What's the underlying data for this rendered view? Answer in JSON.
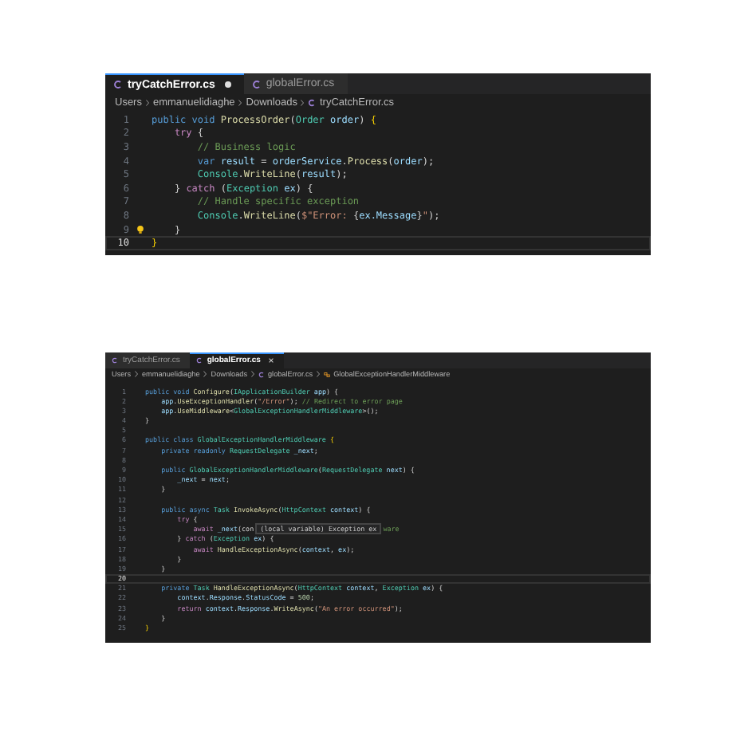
{
  "editors": [
    {
      "tabs": [
        {
          "label": "tryCatchError.cs",
          "selected": true,
          "modified": true,
          "closable": false
        },
        {
          "label": "globalError.cs",
          "selected": false,
          "modified": false,
          "closable": false
        }
      ],
      "breadcrumb": [
        {
          "kind": "folder",
          "text": "Users"
        },
        {
          "kind": "folder",
          "text": "emmanuelidiaghe"
        },
        {
          "kind": "folder",
          "text": "Downloads"
        },
        {
          "kind": "file",
          "text": "tryCatchError.cs"
        }
      ],
      "lines": [
        {
          "number": "1",
          "active": false,
          "lightbulb": false,
          "tokens": [
            {
              "kind": "k",
              "text": "public void "
            },
            {
              "kind": "f",
              "text": "ProcessOrder"
            },
            {
              "kind": "p",
              "text": "("
            },
            {
              "kind": "t",
              "text": "Order "
            },
            {
              "kind": "v",
              "text": "order"
            },
            {
              "kind": "p",
              "text": ") "
            },
            {
              "kind": "b",
              "text": "{"
            }
          ]
        },
        {
          "number": "2",
          "active": false,
          "lightbulb": false,
          "tokens": [
            {
              "kind": "c",
              "text": "    try "
            },
            {
              "kind": "p",
              "text": "{"
            }
          ]
        },
        {
          "number": "3",
          "active": false,
          "lightbulb": false,
          "tokens": [
            {
              "kind": "m",
              "text": "        // Business logic"
            }
          ]
        },
        {
          "number": "4",
          "active": false,
          "lightbulb": false,
          "tokens": [
            {
              "kind": "k",
              "text": "        var "
            },
            {
              "kind": "v",
              "text": "result"
            },
            {
              "kind": "p",
              "text": " = "
            },
            {
              "kind": "v",
              "text": "orderService"
            },
            {
              "kind": "p",
              "text": "."
            },
            {
              "kind": "f",
              "text": "Process"
            },
            {
              "kind": "p",
              "text": "("
            },
            {
              "kind": "v",
              "text": "order"
            },
            {
              "kind": "p",
              "text": ");"
            }
          ]
        },
        {
          "number": "5",
          "active": false,
          "lightbulb": false,
          "tokens": [
            {
              "kind": "t",
              "text": "        Console"
            },
            {
              "kind": "p",
              "text": "."
            },
            {
              "kind": "f",
              "text": "WriteLine"
            },
            {
              "kind": "p",
              "text": "("
            },
            {
              "kind": "v",
              "text": "result"
            },
            {
              "kind": "p",
              "text": ");"
            }
          ]
        },
        {
          "number": "6",
          "active": false,
          "lightbulb": false,
          "tokens": [
            {
              "kind": "p",
              "text": "    } "
            },
            {
              "kind": "c",
              "text": "catch "
            },
            {
              "kind": "p",
              "text": "("
            },
            {
              "kind": "t",
              "text": "Exception "
            },
            {
              "kind": "v",
              "text": "ex"
            },
            {
              "kind": "p",
              "text": ") {"
            }
          ]
        },
        {
          "number": "7",
          "active": false,
          "lightbulb": false,
          "tokens": [
            {
              "kind": "m",
              "text": "        // Handle specific exception"
            }
          ]
        },
        {
          "number": "8",
          "active": false,
          "lightbulb": false,
          "tokens": [
            {
              "kind": "t",
              "text": "        Console"
            },
            {
              "kind": "p",
              "text": "."
            },
            {
              "kind": "f",
              "text": "WriteLine"
            },
            {
              "kind": "p",
              "text": "("
            },
            {
              "kind": "s",
              "text": "$\"Error: "
            },
            {
              "kind": "p",
              "text": "{"
            },
            {
              "kind": "v",
              "text": "ex.Message"
            },
            {
              "kind": "p",
              "text": "}"
            },
            {
              "kind": "s",
              "text": "\""
            },
            {
              "kind": "p",
              "text": ");"
            }
          ]
        },
        {
          "number": "9",
          "active": false,
          "lightbulb": true,
          "tokens": [
            {
              "kind": "p",
              "text": "    }"
            }
          ]
        },
        {
          "number": "10",
          "active": true,
          "lightbulb": false,
          "tokens": [
            {
              "kind": "b",
              "text": "}"
            }
          ]
        }
      ]
    },
    {
      "tabs": [
        {
          "label": "tryCatchError.cs",
          "selected": false,
          "modified": false,
          "closable": false
        },
        {
          "label": "globalError.cs",
          "selected": true,
          "modified": false,
          "closable": true
        }
      ],
      "breadcrumb": [
        {
          "kind": "folder",
          "text": "Users"
        },
        {
          "kind": "folder",
          "text": "emmanuelidiaghe"
        },
        {
          "kind": "folder",
          "text": "Downloads"
        },
        {
          "kind": "file",
          "text": "globalError.cs"
        },
        {
          "kind": "class",
          "text": "GlobalExceptionHandlerMiddleware"
        }
      ],
      "lines": [
        {
          "number": "1",
          "active": false,
          "tokens": [
            {
              "kind": "k",
              "text": "public void "
            },
            {
              "kind": "f",
              "text": "Configure"
            },
            {
              "kind": "p",
              "text": "("
            },
            {
              "kind": "t",
              "text": "IApplicationBuilder "
            },
            {
              "kind": "v",
              "text": "app"
            },
            {
              "kind": "p",
              "text": ") {"
            }
          ]
        },
        {
          "number": "2",
          "active": false,
          "tokens": [
            {
              "kind": "v",
              "text": "    app"
            },
            {
              "kind": "p",
              "text": "."
            },
            {
              "kind": "f",
              "text": "UseExceptionHandler"
            },
            {
              "kind": "p",
              "text": "("
            },
            {
              "kind": "s",
              "text": "\"/Error\""
            },
            {
              "kind": "p",
              "text": "); "
            },
            {
              "kind": "m",
              "text": "// Redirect to error page"
            }
          ]
        },
        {
          "number": "3",
          "active": false,
          "tokens": [
            {
              "kind": "v",
              "text": "    app"
            },
            {
              "kind": "p",
              "text": "."
            },
            {
              "kind": "f",
              "text": "UseMiddleware"
            },
            {
              "kind": "p",
              "text": "<"
            },
            {
              "kind": "t",
              "text": "GlobalExceptionHandlerMiddleware"
            },
            {
              "kind": "p",
              "text": ">();"
            }
          ]
        },
        {
          "number": "4",
          "active": false,
          "tokens": [
            {
              "kind": "p",
              "text": "}"
            }
          ]
        },
        {
          "number": "5",
          "active": false
        },
        {
          "number": "6",
          "active": false,
          "tokens": [
            {
              "kind": "k",
              "text": "public class "
            },
            {
              "kind": "t",
              "text": "GlobalExceptionHandlerMiddleware "
            },
            {
              "kind": "b",
              "text": "{"
            }
          ]
        },
        {
          "number": "7",
          "active": false,
          "tokens": [
            {
              "kind": "k",
              "text": "    private readonly "
            },
            {
              "kind": "t",
              "text": "RequestDelegate "
            },
            {
              "kind": "v",
              "text": "_next"
            },
            {
              "kind": "p",
              "text": ";"
            }
          ]
        },
        {
          "number": "8",
          "active": false
        },
        {
          "number": "9",
          "active": false,
          "tokens": [
            {
              "kind": "k",
              "text": "    public "
            },
            {
              "kind": "t",
              "text": "GlobalExceptionHandlerMiddleware"
            },
            {
              "kind": "p",
              "text": "("
            },
            {
              "kind": "t",
              "text": "RequestDelegate "
            },
            {
              "kind": "v",
              "text": "next"
            },
            {
              "kind": "p",
              "text": ") {"
            }
          ]
        },
        {
          "number": "10",
          "active": false,
          "tokens": [
            {
              "kind": "v",
              "text": "        _next"
            },
            {
              "kind": "p",
              "text": " = "
            },
            {
              "kind": "v",
              "text": "next"
            },
            {
              "kind": "p",
              "text": ";"
            }
          ]
        },
        {
          "number": "11",
          "active": false,
          "tokens": [
            {
              "kind": "p",
              "text": "    }"
            }
          ]
        },
        {
          "number": "12",
          "active": false
        },
        {
          "number": "13",
          "active": false,
          "tokens": [
            {
              "kind": "k",
              "text": "    public async "
            },
            {
              "kind": "t",
              "text": "Task "
            },
            {
              "kind": "f",
              "text": "InvokeAsync"
            },
            {
              "kind": "p",
              "text": "("
            },
            {
              "kind": "t",
              "text": "HttpContext "
            },
            {
              "kind": "v",
              "text": "context"
            },
            {
              "kind": "p",
              "text": ") {"
            }
          ]
        },
        {
          "number": "14",
          "active": false,
          "tokens": [
            {
              "kind": "c",
              "text": "        try "
            },
            {
              "kind": "p",
              "text": "{"
            }
          ]
        },
        {
          "number": "15",
          "active": false,
          "tokens": [
            {
              "kind": "c",
              "text": "            await "
            },
            {
              "kind": "v",
              "text": "_next"
            },
            {
              "kind": "p",
              "text": "(con"
            },
            {
              "kind": "tooltip",
              "text": "(local variable) Exception ex"
            },
            {
              "kind": "m",
              "text": "ware"
            }
          ]
        },
        {
          "number": "16",
          "active": false,
          "tokens": [
            {
              "kind": "p",
              "text": "        } "
            },
            {
              "kind": "c",
              "text": "catch "
            },
            {
              "kind": "p",
              "text": "("
            },
            {
              "kind": "t",
              "text": "Exception "
            },
            {
              "kind": "v",
              "text": "ex"
            },
            {
              "kind": "p",
              "text": ") {"
            }
          ]
        },
        {
          "number": "17",
          "active": false,
          "tokens": [
            {
              "kind": "c",
              "text": "            await "
            },
            {
              "kind": "f",
              "text": "HandleExceptionAsync"
            },
            {
              "kind": "p",
              "text": "("
            },
            {
              "kind": "v",
              "text": "context"
            },
            {
              "kind": "p",
              "text": ", "
            },
            {
              "kind": "v",
              "text": "ex"
            },
            {
              "kind": "p",
              "text": ");"
            }
          ]
        },
        {
          "number": "18",
          "active": false,
          "tokens": [
            {
              "kind": "p",
              "text": "        }"
            }
          ]
        },
        {
          "number": "19",
          "active": false,
          "tokens": [
            {
              "kind": "p",
              "text": "    }"
            }
          ]
        },
        {
          "number": "20",
          "active": true
        },
        {
          "number": "21",
          "active": false,
          "tokens": [
            {
              "kind": "k",
              "text": "    private "
            },
            {
              "kind": "t",
              "text": "Task "
            },
            {
              "kind": "f",
              "text": "HandleExceptionAsync"
            },
            {
              "kind": "p",
              "text": "("
            },
            {
              "kind": "t",
              "text": "HttpContext "
            },
            {
              "kind": "v",
              "text": "context"
            },
            {
              "kind": "p",
              "text": ", "
            },
            {
              "kind": "t",
              "text": "Exception "
            },
            {
              "kind": "v",
              "text": "ex"
            },
            {
              "kind": "p",
              "text": ") {"
            }
          ]
        },
        {
          "number": "22",
          "active": false,
          "tokens": [
            {
              "kind": "v",
              "text": "        context"
            },
            {
              "kind": "p",
              "text": "."
            },
            {
              "kind": "v",
              "text": "Response"
            },
            {
              "kind": "p",
              "text": "."
            },
            {
              "kind": "v",
              "text": "StatusCode"
            },
            {
              "kind": "p",
              "text": " = "
            },
            {
              "kind": "n",
              "text": "500"
            },
            {
              "kind": "p",
              "text": ";"
            }
          ]
        },
        {
          "number": "23",
          "active": false,
          "tokens": [
            {
              "kind": "c",
              "text": "        return "
            },
            {
              "kind": "v",
              "text": "context"
            },
            {
              "kind": "p",
              "text": "."
            },
            {
              "kind": "v",
              "text": "Response"
            },
            {
              "kind": "p",
              "text": "."
            },
            {
              "kind": "f",
              "text": "WriteAsync"
            },
            {
              "kind": "p",
              "text": "("
            },
            {
              "kind": "s",
              "text": "\"An error occurred\""
            },
            {
              "kind": "p",
              "text": ");"
            }
          ]
        },
        {
          "number": "24",
          "active": false,
          "tokens": [
            {
              "kind": "p",
              "text": "    }"
            }
          ]
        },
        {
          "number": "25",
          "active": false,
          "tokens": [
            {
              "kind": "b",
              "text": "}"
            }
          ]
        }
      ]
    }
  ]
}
